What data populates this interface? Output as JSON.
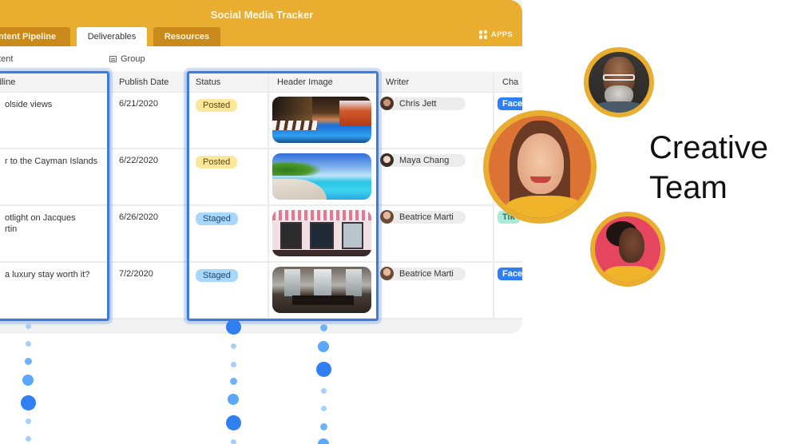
{
  "app": {
    "title": "Social Media Tracker",
    "tabs": [
      {
        "label": "Content Pipeline",
        "visible_label": "ntent Pipeline",
        "active": false
      },
      {
        "label": "Deliverables",
        "active": true
      },
      {
        "label": "Resources",
        "active": false
      }
    ],
    "apps_label": "APPS",
    "view_name": "ntent",
    "group_label": "Group"
  },
  "columns": {
    "headline": "adline",
    "publish_date": "Publish Date",
    "status": "Status",
    "header_image": "Header Image",
    "writer": "Writer",
    "channel": "Cha"
  },
  "rows": [
    {
      "headline": "olside views",
      "publish_date": "6/21/2020",
      "status": "Posted",
      "image": "rooftop-pool-photo",
      "writer": "Chris Jett",
      "channel": "Face",
      "channel_type": "facebook"
    },
    {
      "headline": "r to the Cayman Islands",
      "publish_date": "6/22/2020",
      "status": "Posted",
      "image": "tropical-beach-photo",
      "writer": "Maya Chang",
      "channel": "",
      "channel_type": "none"
    },
    {
      "headline": "otlight on Jacques\nrtin",
      "publish_date": "6/26/2020",
      "status": "Staged",
      "image": "storefront-awnings-photo",
      "writer": "Beatrice Marti",
      "channel": "Tik",
      "channel_type": "tiktok"
    },
    {
      "headline": "a luxury stay worth it?",
      "publish_date": "7/2/2020",
      "status": "Staged",
      "image": "hotel-lobby-photo",
      "writer": "Beatrice Marti",
      "channel": "Face",
      "channel_type": "facebook"
    }
  ],
  "side": {
    "title_line1": "Creative",
    "title_line2": "Team",
    "avatars": [
      "team-member-man-glasses",
      "team-member-woman-orange",
      "team-member-woman-red"
    ]
  },
  "colors": {
    "brand": "#e9ae2f",
    "tab_inactive": "#c98a1b",
    "selection": "#3b7ce0",
    "posted": "#fde79a",
    "staged": "#a7d8fb",
    "facebook": "#2d7ff9",
    "tiktok": "#a8ecd8"
  }
}
